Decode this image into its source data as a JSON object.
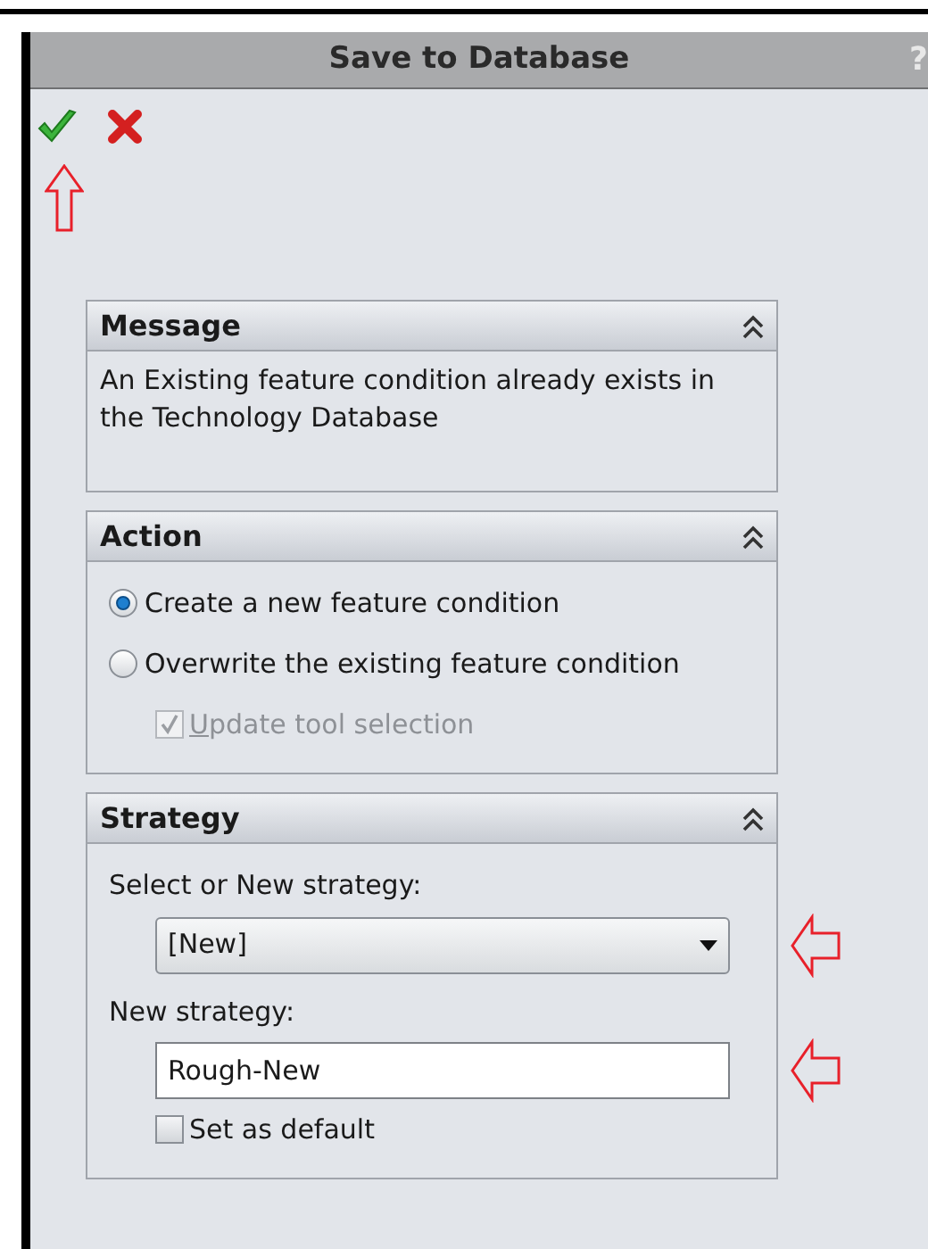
{
  "window": {
    "title": "Save to Database",
    "help": "?"
  },
  "panels": [
    {
      "title": "Message",
      "expanded": true,
      "items": [
        {
          "kind": "text",
          "text": "An Existing feature condition already exists in the Technology Database"
        }
      ]
    },
    {
      "title": "Action",
      "expanded": true,
      "items": [
        {
          "kind": "radio",
          "label": "Create a new feature condition",
          "selected": true
        },
        {
          "kind": "radio",
          "label": "Overwrite the existing feature condition",
          "selected": false
        },
        {
          "kind": "checkbox",
          "label": "Update tool selection",
          "checked": true,
          "disabled": true
        }
      ]
    },
    {
      "title": "Strategy",
      "expanded": true,
      "items": [
        {
          "kind": "label",
          "text": "Select or New strategy:"
        },
        {
          "kind": "dropdown",
          "value": "[New]"
        },
        {
          "kind": "label",
          "text": "New strategy:"
        },
        {
          "kind": "input",
          "value": "Rough-New"
        },
        {
          "kind": "checkbox",
          "label": "Set as default",
          "checked": false,
          "disabled": false
        }
      ]
    }
  ]
}
